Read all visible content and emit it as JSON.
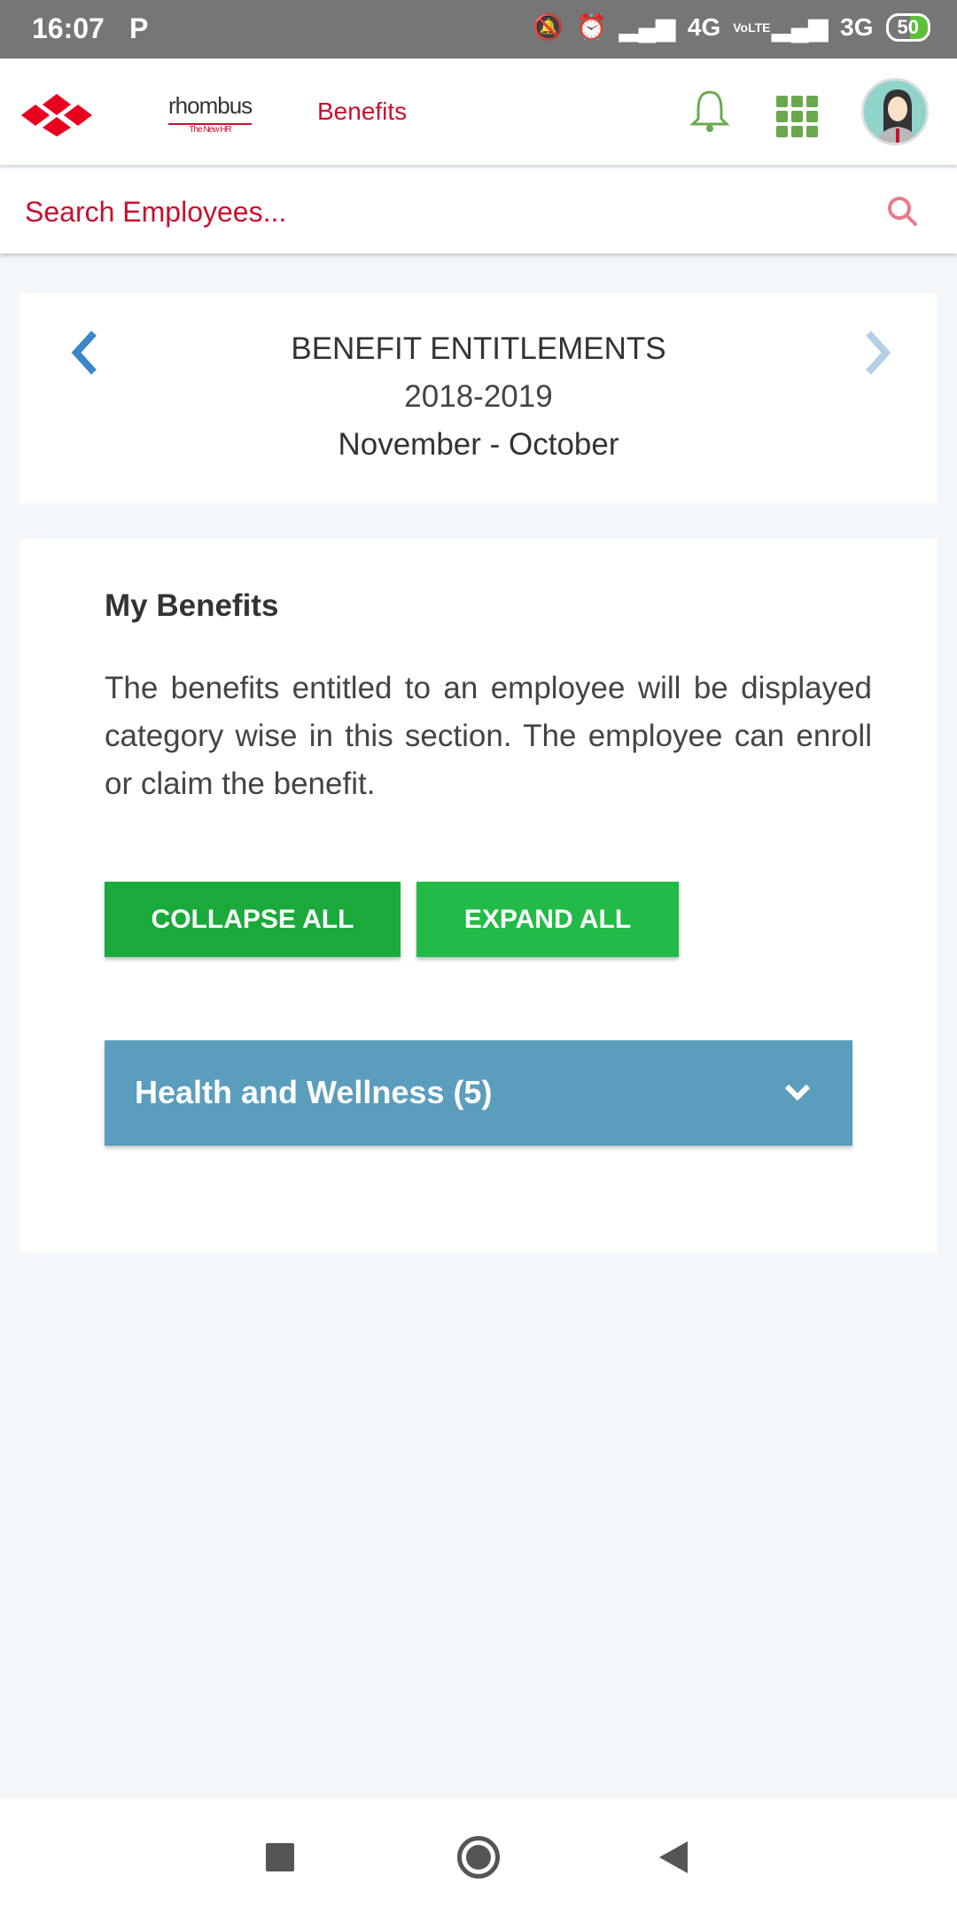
{
  "status_bar": {
    "time": "16:07",
    "app_indicator": "P",
    "network1": "4G",
    "volte": "VoLTE",
    "network2": "3G",
    "battery": "50"
  },
  "header": {
    "brand": "rhombus",
    "tagline": "The New HR",
    "page_title": "Benefits",
    "icons": [
      "rhombus-logo-icon",
      "bell-icon",
      "apps-grid-icon",
      "avatar"
    ]
  },
  "search": {
    "placeholder": "Search Employees..."
  },
  "period": {
    "title": "BENEFIT ENTITLEMENTS",
    "year": "2018-2019",
    "months": "November - October"
  },
  "benefits": {
    "heading": "My Benefits",
    "description": "The benefits entitled to an employee will be displayed category wise in this section. The employee can enroll or claim the benefit.",
    "collapse_label": "COLLAPSE ALL",
    "expand_label": "EXPAND ALL",
    "categories": [
      {
        "label": "Health and Wellness (5)"
      }
    ]
  },
  "colors": {
    "brand_red": "#c8102e",
    "green": "#1aaa3c",
    "accordion_blue": "#5b9dbd"
  }
}
